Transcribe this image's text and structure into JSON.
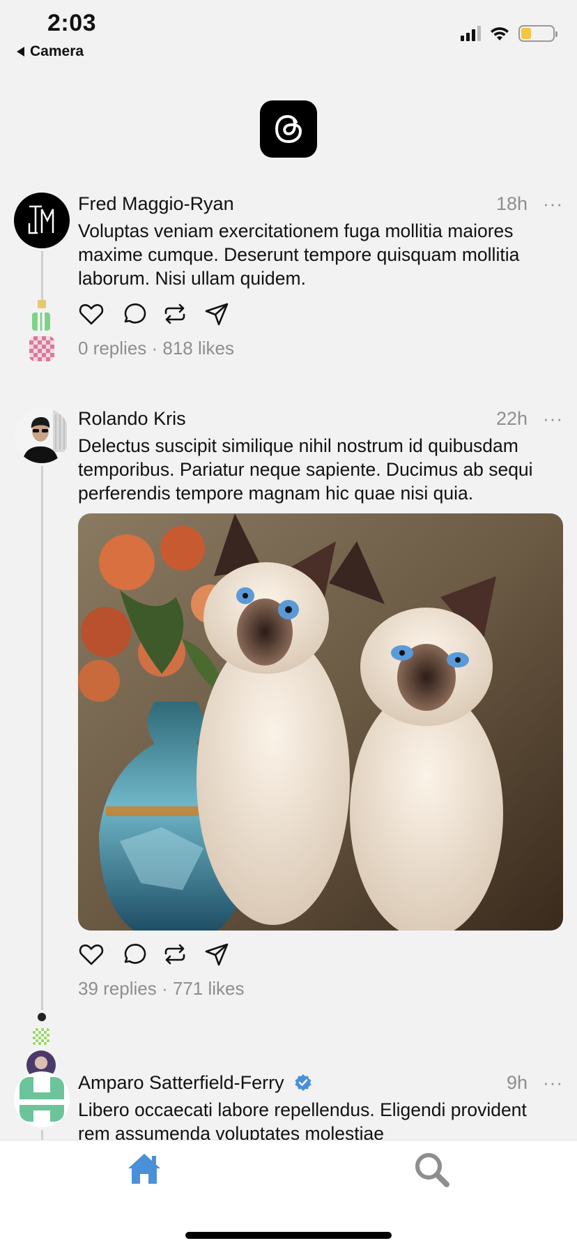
{
  "status_bar": {
    "time": "2:03",
    "back_label": "Camera",
    "icons": [
      "cellular-signal-icon",
      "wifi-icon",
      "battery-icon"
    ],
    "battery_color": "#f5c543"
  },
  "app": {
    "logo": "threads-logo-icon"
  },
  "posts": [
    {
      "author": "Fred Maggio-Ryan",
      "time": "18h",
      "more": "···",
      "text": "Voluptas veniam exercitationem fuga mollitia maiores maxime cumque. Deserunt tempore quisquam mollitia laborum. Nisi ullam quidem.",
      "stats": "0 replies · 818 likes"
    },
    {
      "author": "Rolando Kris",
      "time": "22h",
      "more": "···",
      "text": "Delectus suscipit similique nihil nostrum id quibusdam temporibus. Pariatur neque sapiente. Ducimus ab sequi perferendis tempore magnam hic quae nisi quia.",
      "image": "siamese-cats-with-flower-vase-image",
      "stats": "39 replies · 771 likes"
    },
    {
      "author": "Amparo Satterfield-Ferry",
      "verified": true,
      "verified_color": "#4a90d9",
      "time": "9h",
      "more": "···",
      "text": "Libero occaecati labore repellendus. Eligendi provident rem assumenda voluptates molestiae"
    }
  ],
  "actions": [
    "heart-icon",
    "comment-icon",
    "repost-icon",
    "share-icon"
  ],
  "tab_bar": {
    "items": [
      "home-icon",
      "search-icon"
    ],
    "active_color": "#4a90d9",
    "inactive_color": "#8e8e8e"
  }
}
